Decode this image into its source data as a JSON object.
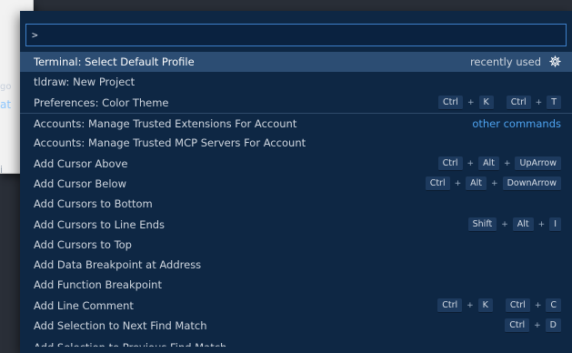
{
  "background": {
    "fragment_1": "go",
    "fragment_2": "at",
    "fragment_3": "i"
  },
  "search": {
    "value": ">"
  },
  "items": [
    {
      "label": "Terminal: Select Default Profile",
      "right_text": "recently used",
      "right_icon": "gear-icon",
      "selected": true
    },
    {
      "label": "tldraw: New Project"
    },
    {
      "label": "Preferences: Color Theme",
      "keys": [
        [
          "Ctrl",
          "K"
        ],
        [
          "Ctrl",
          "T"
        ]
      ]
    },
    {
      "label": "Accounts: Manage Trusted Extensions For Account",
      "right_text": "other commands"
    },
    {
      "label": "Accounts: Manage Trusted MCP Servers For Account"
    },
    {
      "label": "Add Cursor Above",
      "keys": [
        [
          "Ctrl",
          "Alt",
          "UpArrow"
        ]
      ]
    },
    {
      "label": "Add Cursor Below",
      "keys": [
        [
          "Ctrl",
          "Alt",
          "DownArrow"
        ]
      ]
    },
    {
      "label": "Add Cursors to Bottom"
    },
    {
      "label": "Add Cursors to Line Ends",
      "keys": [
        [
          "Shift",
          "Alt",
          "I"
        ]
      ]
    },
    {
      "label": "Add Cursors to Top"
    },
    {
      "label": "Add Data Breakpoint at Address"
    },
    {
      "label": "Add Function Breakpoint"
    },
    {
      "label": "Add Line Comment",
      "keys": [
        [
          "Ctrl",
          "K"
        ],
        [
          "Ctrl",
          "C"
        ]
      ]
    },
    {
      "label": "Add Selection to Next Find Match",
      "keys": [
        [
          "Ctrl",
          "D"
        ]
      ]
    },
    {
      "label": "Add Selection to Previous Find Match"
    }
  ],
  "colors": {
    "palette_bg": "#0e2744",
    "selected_bg": "#2c4d73",
    "accent": "#4ea3f0",
    "input_border": "#3d7fc9"
  }
}
